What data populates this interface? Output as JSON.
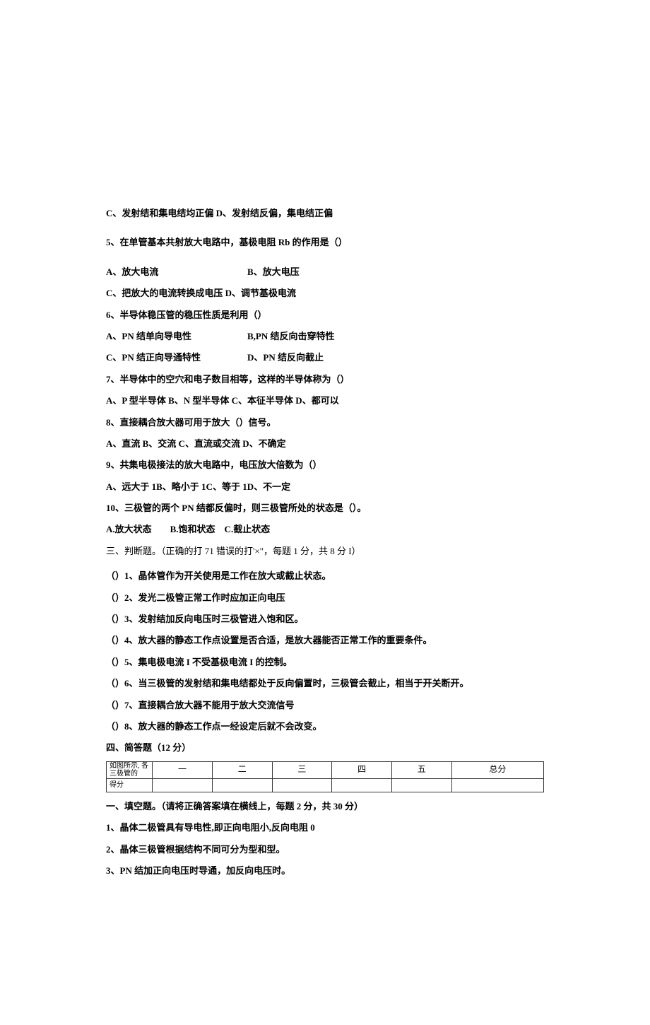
{
  "q4c": "C、发射结和集电结均正偏 D、发射结反偏，集电结正偏",
  "q5_stem": "5、在单管基本共射放大电路中，基极电阻 Rb 的作用是（）",
  "q5_a": "A、放大电流",
  "q5_b": "B、放大电压",
  "q5_cd": "C、把放大的电流转换成电压 D、调节基极电流",
  "q6_stem": "6、半导体稳压管的稳压性质是利用（）",
  "q6_a": "A、PN 结单向导电性",
  "q6_b": "B,PN 结反向击穿特性",
  "q6_c": "C、PN 结正向导通特性",
  "q6_d": "D、PN 结反向截止",
  "q7_stem": "7、半导体中的空穴和电子数目相等，这样的半导体称为（）",
  "q7_opts": "A、P 型半导体 B、N 型半导体 C、本征半导体 D、都可以",
  "q8_stem": "8、直接耦合放大器可用于放大（）信号。",
  "q8_opts": "A、直流 B、交流 C、直流或交流 D、不确定",
  "q9_stem": "9、共集电极接法的放大电路中，电压放大倍数为（）",
  "q9_opts": "A、远大于 1B、略小于 1C、等于 1D、不一定",
  "q10_stem": "10、三极管的两个 PN 结都反偏时，则三极管所处的状态是（）。",
  "q10_opts": "A.放大状态  B.饱和状态 C.截止状态",
  "s3_title": "三、判断题。（正确的打 71 错误的打'×\"，每题 1 分，共 8 分 I）",
  "j1": "（）1、晶体管作为开关使用是工作在放大或截止状态。",
  "j2": "（）2、发光二极管正常工作时应加正向电压",
  "j3": "（）3、发射结加反向电压时三极管进入饱和区。",
  "j4": "（）4、放大器的静态工作点设置是否合适，是放大器能否正常工作的重要条件。",
  "j5": "（）5、集电极电流 I 不受基极电流 I 的控制。",
  "j6": "（）6、当三极管的发射结和集电结都处于反向偏置时，三极管会截止，相当于开关断开。",
  "j7": "（）7、直接耦合放大器不能用于放大交流信号",
  "j8": "（）8、放大器的静态工作点一经设定后就不会改变。",
  "s4_title": "四、简答题（12 分）",
  "table": {
    "r1c0": "如图所示,\n各三极管的",
    "r1c1": "一",
    "r1c2": "二",
    "r1c3": "三",
    "r1c4": "四",
    "r1c5": "五",
    "r1c6": "总分",
    "r2c0": "得分"
  },
  "s1_title": "一、填空题。（请将正确答案填在横线上，每题 2 分，共 30 分）",
  "f1": "1、晶体二极管具有导电性,即正向电阻小,反向电阻 0",
  "f2": "2、晶体三极管根据结构不同可分为型和型。",
  "f3": "3、PN 结加正向电压时导通，加反向电压时。"
}
